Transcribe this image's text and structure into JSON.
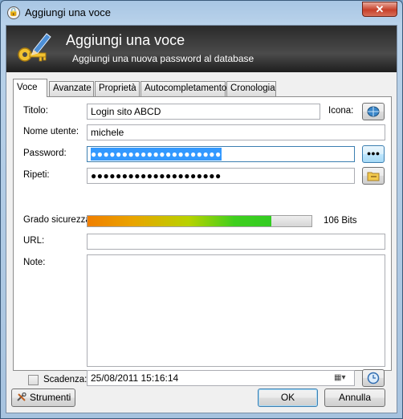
{
  "window": {
    "title": "Aggiungi una voce",
    "close_glyph": "✕"
  },
  "banner": {
    "title": "Aggiungi una voce",
    "subtitle": "Aggiungi una nuova password al database",
    "icon": "key-pen-icon"
  },
  "tabs": [
    {
      "label": "Voce",
      "active": true
    },
    {
      "label": "Avanzate",
      "active": false
    },
    {
      "label": "Proprietà",
      "active": false
    },
    {
      "label": "Autocompletamento",
      "active": false
    },
    {
      "label": "Cronologia",
      "active": false
    }
  ],
  "form": {
    "title_label": "Titolo:",
    "title_value": "Login sito ABCD",
    "icon_label": "Icona:",
    "user_label": "Nome utente:",
    "user_value": "michele",
    "password_label": "Password:",
    "password_value": "●●●●●●●●●●●●●●●●●●●●●",
    "show_password_button": "●●●",
    "repeat_label": "Ripeti:",
    "repeat_value": "●●●●●●●●●●●●●●●●●●●●●",
    "strength_label": "Grado sicurezza:",
    "strength_fraction": 0.82,
    "strength_bits": "106 Bits",
    "url_label": "URL:",
    "url_value": "",
    "notes_label": "Note:",
    "notes_value": "",
    "expiry_label": "Scadenza:",
    "expiry_checked": false,
    "expiry_value": "25/08/2011 15:16:14"
  },
  "footer": {
    "tools_button": "Strumenti",
    "ok_button": "OK",
    "cancel_button": "Annulla"
  },
  "colors": {
    "selection": "#3399ff",
    "banner": "#2a2a2a",
    "accent": "#3c7fb1"
  }
}
